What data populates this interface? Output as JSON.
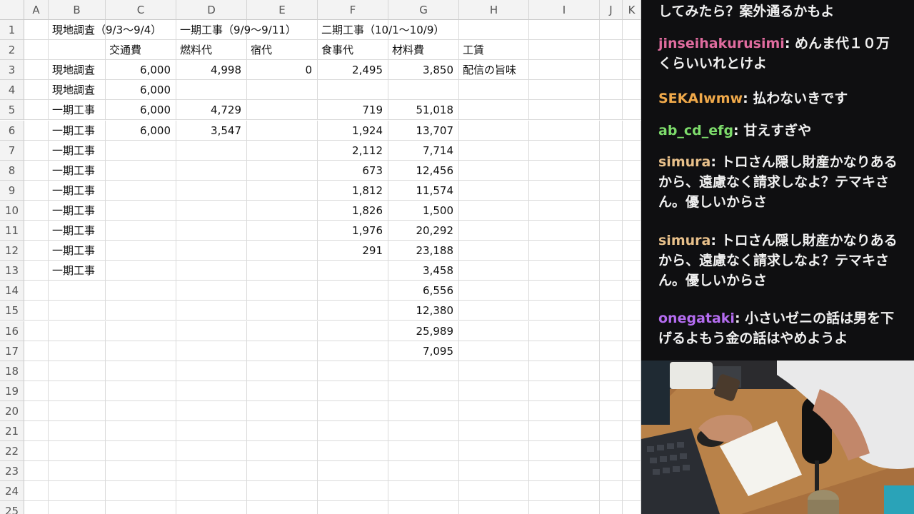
{
  "sheet": {
    "columns": [
      "A",
      "B",
      "C",
      "D",
      "E",
      "F",
      "G",
      "H",
      "I",
      "J",
      "K"
    ],
    "rows": [
      "1",
      "2",
      "3",
      "4",
      "5",
      "6",
      "7",
      "8",
      "9",
      "10",
      "11",
      "12",
      "13",
      "14",
      "15",
      "16",
      "17",
      "18",
      "19",
      "20",
      "21",
      "22",
      "23",
      "24",
      "25"
    ],
    "r1": {
      "b": "現地調査（9/3〜9/4）",
      "d": "一期工事（9/9〜9/11）",
      "f": "二期工事（10/1〜10/9）"
    },
    "r2": {
      "c": "交通費",
      "d": "燃料代",
      "e": "宿代",
      "f": "食事代",
      "g": "材料費",
      "h": "工賃"
    },
    "r3": {
      "b": "現地調査",
      "c": "6,000",
      "d": "4,998",
      "e": "0",
      "f": "2,495",
      "g": "3,850",
      "h": "配信の旨味"
    },
    "r4": {
      "b": "現地調査",
      "c": "6,000"
    },
    "r5": {
      "b": "一期工事",
      "c": "6,000",
      "d": "4,729",
      "f": "719",
      "g": "51,018"
    },
    "r6": {
      "b": "一期工事",
      "c": "6,000",
      "d": "3,547",
      "f": "1,924",
      "g": "13,707"
    },
    "r7": {
      "b": "一期工事",
      "f": "2,112",
      "g": "7,714"
    },
    "r8": {
      "b": "一期工事",
      "f": "673",
      "g": "12,456"
    },
    "r9": {
      "b": "一期工事",
      "f": "1,812",
      "g": "11,574"
    },
    "r10": {
      "b": "一期工事",
      "f": "1,826",
      "g": "1,500"
    },
    "r11": {
      "b": "一期工事",
      "f": "1,976",
      "g": "20,292"
    },
    "r12": {
      "b": "一期工事",
      "f": "291",
      "g": "23,188"
    },
    "r13": {
      "b": "一期工事",
      "g": "3,458"
    },
    "r14": {
      "g": "6,556"
    },
    "r15": {
      "g": "12,380"
    },
    "r16": {
      "g": "25,989"
    },
    "r17": {
      "g": "7,095"
    }
  },
  "chat": {
    "messages": [
      {
        "user": "",
        "text": "してみたら？案外通るかもよ",
        "color": "#f1f1f1"
      },
      {
        "user": "jinseihakurusimi",
        "text": "めんま代１０万くらいいれとけよ",
        "color": "#e06c9f"
      },
      {
        "user": "SEKAIwmw",
        "text": "払わないきです",
        "color": "#f0a94a"
      },
      {
        "user": "ab_cd_efg",
        "text": "甘えすぎや",
        "color": "#7ddc6b"
      },
      {
        "user": "simura",
        "text": "トロさん隠し財産かなりあるから、遠慮なく請求しなよ？テマキさん。優しいからさ",
        "color": "#e8c08a"
      },
      {
        "user": "simura",
        "text": "トロさん隠し財産かなりあるから、遠慮なく請求しなよ？テマキさん。優しいからさ",
        "color": "#e8c08a"
      },
      {
        "user": "onegataki",
        "text": "小さいゼニの話は男を下げるよもう金の話はやめようよ",
        "color": "#b46cf0"
      }
    ]
  }
}
